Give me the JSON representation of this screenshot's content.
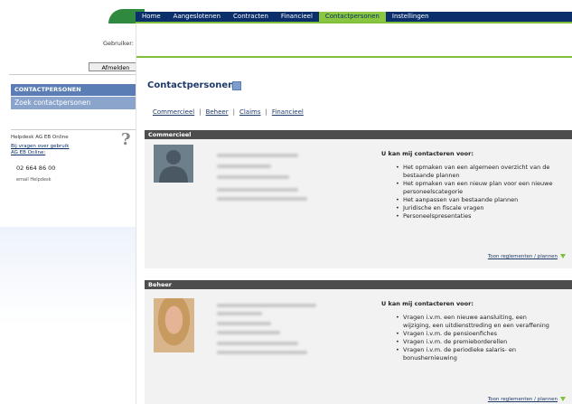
{
  "nav": {
    "items": [
      "Home",
      "Aangeslotenen",
      "Contracten",
      "Financieel",
      "Contactpersonen",
      "Instellingen"
    ],
    "active_index": 4
  },
  "sidebar": {
    "login_label": "Gebruiker:",
    "logout_label": "Afmelden",
    "contact_label": "CONTACTPERSONEN",
    "search_label": "Zoek contactpersonen",
    "helpdesk": {
      "title": "Helpdesk AG EB Online",
      "link_line1": "Bij vragen over gebruik",
      "link_line2": "AG EB Online:",
      "phone": "02 664 86 00",
      "email": "email Helpdesk",
      "icon": "question-mark-icon"
    }
  },
  "main": {
    "title": "Contactpersonen",
    "tabs": [
      "Commercieel",
      "Beheer",
      "Claims",
      "Financieel"
    ],
    "sections": [
      {
        "name": "Commercieel",
        "heading": "U kan mij contacteren voor:",
        "items": [
          "Het opmaken van een algemeen overzicht van de",
          "bestaande plannen",
          "Het opmaken van een nieuw plan voor een nieuwe",
          "personeelscategorie",
          "Het aanpassen van bestaande plannen",
          "Juridische en fiscale vragen",
          "Personeelspresentaties"
        ],
        "show_link": "Toon reglementen / plannen"
      },
      {
        "name": "Beheer",
        "heading": "U kan mij contacteren voor:",
        "items": [
          "Vragen i.v.m. een nieuwe aansluiting, een",
          "wijziging, een uitdiensttreding en een veraffening",
          "Vragen i.v.m. de pensioenfiches",
          "Vragen i.v.m. de premieborderellen",
          "Vragen i.v.m. de periodieke salaris- en",
          "bonushernieuwing"
        ],
        "show_link": "Toon reglementen / plannen"
      }
    ]
  },
  "colors": {
    "nav_bg": "#0b2f6b",
    "nav_active": "#8ac63f",
    "accent_green": "#7fbf3b",
    "section_bar": "#4d4d4d",
    "sidebar_active": "#5a7db5"
  }
}
